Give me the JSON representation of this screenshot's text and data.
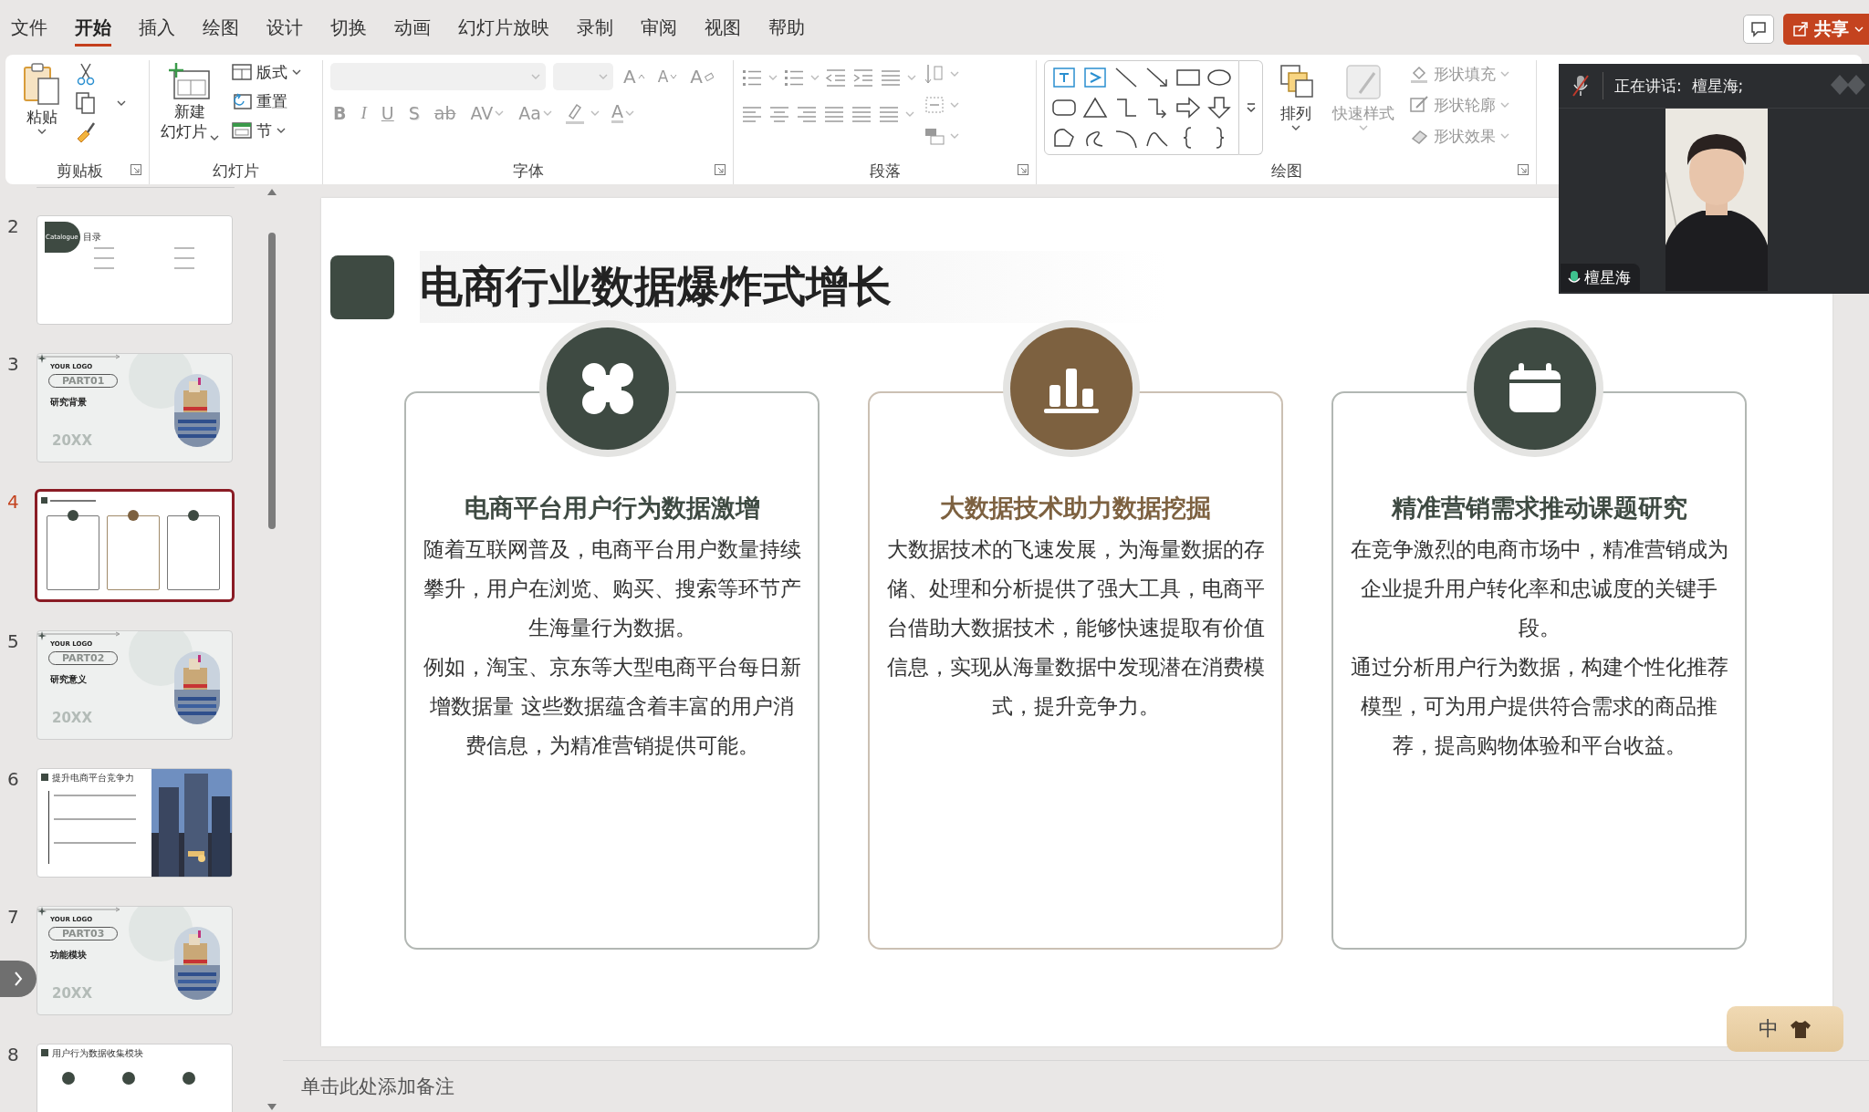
{
  "menu_tabs": [
    {
      "label": "文件",
      "selected": false
    },
    {
      "label": "开始",
      "selected": true
    },
    {
      "label": "插入",
      "selected": false
    },
    {
      "label": "绘图",
      "selected": false
    },
    {
      "label": "设计",
      "selected": false
    },
    {
      "label": "切换",
      "selected": false
    },
    {
      "label": "动画",
      "selected": false
    },
    {
      "label": "幻灯片放映",
      "selected": false
    },
    {
      "label": "录制",
      "selected": false
    },
    {
      "label": "审阅",
      "selected": false
    },
    {
      "label": "视图",
      "selected": false
    },
    {
      "label": "帮助",
      "selected": false
    }
  ],
  "share_button": {
    "label": "共享"
  },
  "ribbon": [
    {
      "kind": "clipboard",
      "label": "剪贴板",
      "paste": "粘贴"
    },
    {
      "kind": "slides",
      "label": "幻灯片",
      "new_slide": [
        "新建",
        "幻灯片"
      ],
      "layout": "版式",
      "reset": "重置",
      "section": "节"
    },
    {
      "kind": "font",
      "label": "字体",
      "disabled": true,
      "size_buttons": [
        {
          "kind": "grow",
          "label": "A"
        },
        {
          "kind": "shrink",
          "label": "A"
        },
        {
          "kind": "clear",
          "label": "A"
        }
      ],
      "format_buttons": [
        {
          "kind": "bold",
          "label": "B"
        },
        {
          "kind": "italic",
          "label": "I"
        },
        {
          "kind": "underline",
          "label": "U"
        },
        {
          "kind": "shadow",
          "label": "S"
        },
        {
          "kind": "strike",
          "label": "ab"
        },
        {
          "kind": "spacing",
          "label": "AV"
        },
        {
          "kind": "case",
          "label": "Aa"
        }
      ],
      "font_color": "A"
    },
    {
      "kind": "paragraph",
      "label": "段落",
      "disabled": true
    },
    {
      "kind": "drawing",
      "label": "绘图",
      "arrange": {
        "label": "排列",
        "disabled": false
      },
      "quick_styles": {
        "label": "快速样式",
        "disabled": true
      },
      "shape_commands": [
        {
          "label": "形状填充",
          "disabled": true
        },
        {
          "label": "形状轮廓",
          "disabled": true
        },
        {
          "label": "形状效果",
          "disabled": true
        }
      ]
    }
  ],
  "thumbnails": [
    {
      "number": "2",
      "selected": false,
      "kind": "catalogue",
      "badge": "Catalogue",
      "heading": "目录"
    },
    {
      "number": "3",
      "selected": false,
      "kind": "part",
      "logo": "YOUR LOGO",
      "part": "PART01",
      "title": "研究背景",
      "year": "20XX"
    },
    {
      "number": "4",
      "selected": true,
      "kind": "cards"
    },
    {
      "number": "5",
      "selected": false,
      "kind": "part",
      "logo": "YOUR LOGO",
      "part": "PART02",
      "title": "研究意义",
      "year": "20XX"
    },
    {
      "number": "6",
      "selected": false,
      "title": "提升电商平台竞争力"
    },
    {
      "number": "7",
      "selected": false,
      "kind": "part",
      "logo": "YOUR LOGO",
      "part": "PART03",
      "title": "功能模块",
      "year": "20XX"
    },
    {
      "number": "8",
      "selected": false,
      "kind": "modules",
      "title": "用户行为数据收集模块"
    }
  ],
  "slide": {
    "title": "电商行业数据爆炸式增长",
    "cards": [
      {
        "kind": "grid",
        "color": "#3e4a42",
        "heading": "电商平台用户行为数据激增",
        "paragraphs": [
          "随着互联网普及，电商平台用户数量持续攀升，用户在浏览、购买、搜索等环节产生海量行为数据。",
          "例如，淘宝、京东等大型电商平台每日新增数据量 这些数据蕴含着丰富的用户消费信息，为精准营销提供可能。"
        ]
      },
      {
        "kind": "bar-chart",
        "color": "#7d6140",
        "heading": "大数据技术助力数据挖掘",
        "paragraphs": [
          "大数据技术的飞速发展，为海量数据的存储、处理和分析提供了强大工具，电商平台借助大数据技术，能够快速提取有价值信息，实现从海量数据中发现潜在消费模式，提升竞争力。"
        ]
      },
      {
        "kind": "calendar",
        "color": "#3e4a42",
        "heading": "精准营销需求推动课题研究",
        "paragraphs": [
          "在竞争激烈的电商市场中，精准营销成为企业提升用户转化率和忠诚度的关键手段。",
          "通过分析用户行为数据，构建个性化推荐模型，可为用户提供符合需求的商品推荐，提高购物体验和平台收益。"
        ]
      }
    ]
  },
  "notes": {
    "placeholder": "单击此处添加备注"
  },
  "video_call": {
    "status": "正在讲话:  檀星海;",
    "muted": true,
    "participant": "檀星海"
  },
  "ime": {
    "mode": "中"
  }
}
